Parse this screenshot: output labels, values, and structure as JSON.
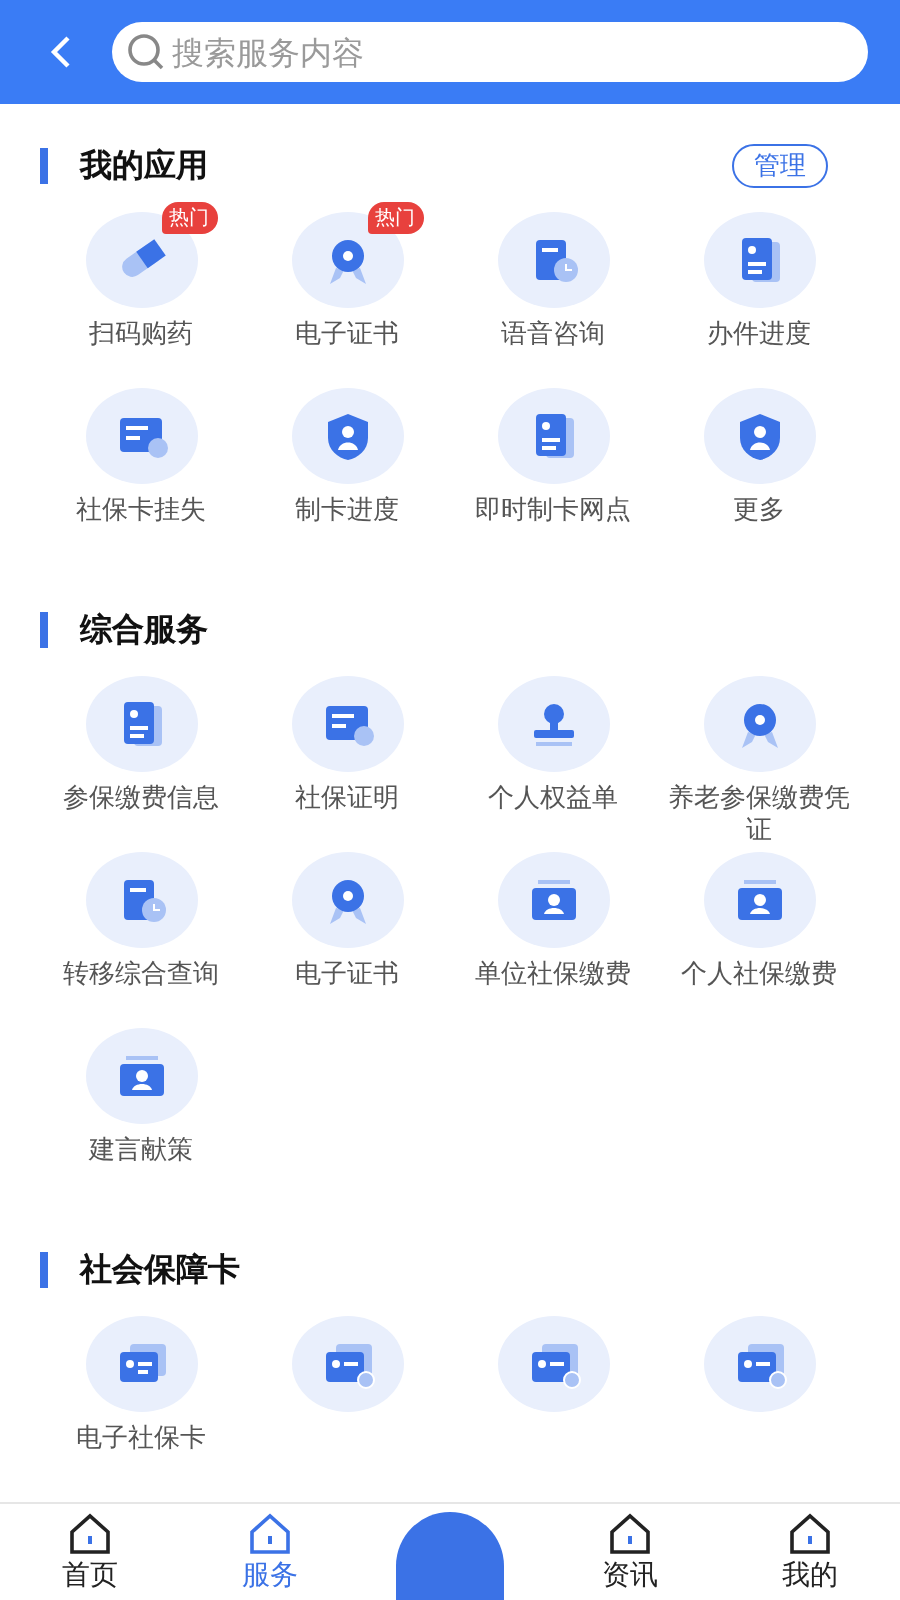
{
  "header": {
    "search": {
      "placeholder": "搜索服务内容"
    }
  },
  "sections": [
    {
      "title": "我的应用",
      "action": "管理",
      "items": [
        {
          "label": "扫码购药",
          "badge": "热门"
        },
        {
          "label": "电子证书",
          "badge": "热门"
        },
        {
          "label": "语音咨询"
        },
        {
          "label": "办件进度"
        },
        {
          "label": "社保卡挂失"
        },
        {
          "label": "制卡进度"
        },
        {
          "label": "即时制卡网点"
        },
        {
          "label": "更多"
        }
      ]
    },
    {
      "title": "综合服务",
      "items": [
        {
          "label": "参保缴费信息"
        },
        {
          "label": "社保证明"
        },
        {
          "label": "个人权益单"
        },
        {
          "label": "养老参保缴费凭证"
        },
        {
          "label": "转移综合查询"
        },
        {
          "label": "电子证书"
        },
        {
          "label": "单位社保缴费"
        },
        {
          "label": "个人社保缴费"
        },
        {
          "label": "建言献策"
        }
      ]
    },
    {
      "title": "社会保障卡",
      "items": [
        {
          "label": "电子社保卡",
          "marked": false
        },
        {
          "marked": true
        },
        {
          "marked": true
        },
        {
          "marked": true
        }
      ]
    }
  ],
  "tabbar": [
    {
      "kind": "tab",
      "label": "首页",
      "selected": false
    },
    {
      "kind": "tab",
      "label": "服务",
      "selected": true
    },
    {
      "kind": "center"
    },
    {
      "kind": "tab",
      "label": "资讯",
      "selected": false
    },
    {
      "kind": "tab",
      "label": "我的",
      "selected": false
    }
  ]
}
